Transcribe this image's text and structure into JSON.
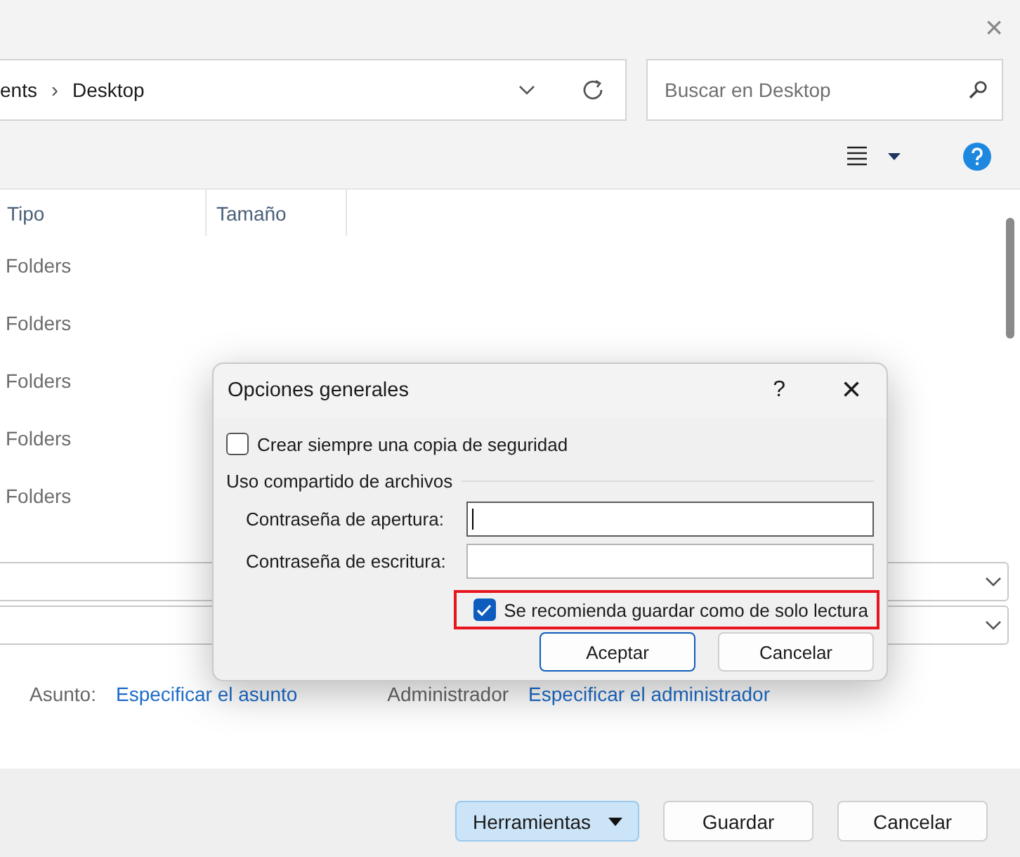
{
  "window": {
    "close": "×"
  },
  "address": {
    "path": [
      {
        "label": "ents"
      },
      {
        "label": "Desktop"
      }
    ],
    "separator": "›"
  },
  "search": {
    "placeholder": "Buscar en Desktop"
  },
  "columns": [
    {
      "label": "Tipo"
    },
    {
      "label": "Tamaño"
    }
  ],
  "rows": [
    {
      "type": "Folders"
    },
    {
      "type": "Folders"
    },
    {
      "type": "Folders"
    },
    {
      "type": "Folders"
    },
    {
      "type": "Folders"
    }
  ],
  "fields": [
    {
      "label": "Asunto:",
      "link": "Especificar el asunto"
    },
    {
      "label": "Administrador",
      "link": "Especificar el administrador"
    }
  ],
  "buttons": [
    {
      "label": "Herramientas",
      "kind": "menu"
    },
    {
      "label": "Guardar",
      "kind": "plain"
    },
    {
      "label": "Cancelar",
      "kind": "plain"
    }
  ],
  "dialog": {
    "title": "Opciones generales",
    "help": "?",
    "close": "×",
    "backup": {
      "label": "Crear siempre una copia de seguridad",
      "checked": false
    },
    "group": "Uso compartido de archivos",
    "passwords": [
      {
        "label": "Contraseña de apertura:",
        "focused": true
      },
      {
        "label": "Contraseña de escritura:",
        "focused": false
      }
    ],
    "readonly": {
      "label": "Se recomienda guardar como de solo lectura",
      "checked": true,
      "highlighted": true
    },
    "buttons": [
      {
        "label": "Aceptar",
        "default": true
      },
      {
        "label": "Cancelar",
        "default": false
      }
    ]
  }
}
